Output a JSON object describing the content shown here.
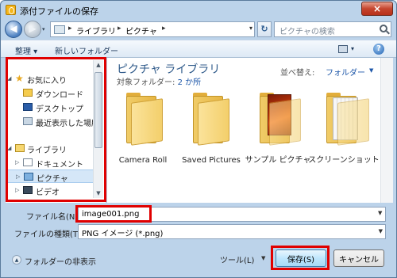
{
  "window": {
    "title": "添付ファイルの保存",
    "close_label": "×"
  },
  "address": {
    "back_label": "◀",
    "forward_label": "▶",
    "recent_label": "▾",
    "separator": "▸",
    "crumbs": [
      "ライブラリ",
      "ピクチャ"
    ],
    "drop_label": "▾",
    "refresh_label": "↻",
    "search_placeholder": "ピクチャの検索"
  },
  "toolbar": {
    "organize": "整理 ▾",
    "new_folder": "新しいフォルダー",
    "view_drop": "▾",
    "help": "?"
  },
  "nav": {
    "favorites": "お気に入り",
    "downloads": "ダウンロード",
    "desktop": "デスクトップ",
    "recent": "最近表示した場所",
    "libraries": "ライブラリ",
    "documents": "ドキュメント",
    "pictures": "ピクチャ",
    "videos": "ビデオ",
    "expand": "▷",
    "collapse": "◢",
    "scroll_up": "▲",
    "scroll_down": "▼",
    "favorites_star": "★"
  },
  "content": {
    "library_title": "ピクチャ ライブラリ",
    "target_prefix": "対象フォルダー: ",
    "target_count": "2 か所",
    "arrange_label": "並べ替え:",
    "arrange_value": "フォルダー",
    "arrange_drop": "▼",
    "folders": [
      {
        "label": "Camera Roll"
      },
      {
        "label": "Saved Pictures"
      },
      {
        "label": "サンプル ピクチャ"
      },
      {
        "label": "スクリーンショット"
      }
    ]
  },
  "form": {
    "filename_label": "ファイル名(N):",
    "filename_value": "image001.png",
    "filetype_label": "ファイルの種類(T):",
    "filetype_value": "PNG イメージ (*.png)",
    "drop": "▼"
  },
  "footer": {
    "hide_folders": "フォルダーの非表示",
    "hide_icon": "▲",
    "tools": "ツール(L)",
    "tools_drop": "▼",
    "save": "保存(S)",
    "cancel": "キャンセル"
  },
  "colors": {
    "highlight": "#e00000",
    "accent": "#2f5a8a",
    "window": "#bcd3ea"
  }
}
